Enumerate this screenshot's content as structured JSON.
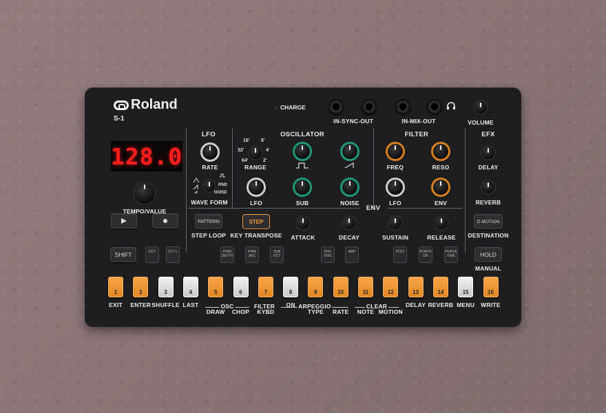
{
  "brand": {
    "logo": "Roland",
    "model": "S-1"
  },
  "top": {
    "charge": "CHARGE",
    "sync": "IN-SYNC-OUT",
    "mix": "IN-MIX-OUT",
    "volume": "VOLUME"
  },
  "display": {
    "value": "128.0"
  },
  "sections": {
    "lfo": "LFO",
    "oscillator": "OSCILLATOR",
    "filter": "FILTER",
    "efx": "EFX",
    "env": "ENV"
  },
  "knobs": {
    "lfo_rate": "RATE",
    "range": "RANGE",
    "wave_form": "WAVE FORM",
    "osc_lfo": "LFO",
    "sub": "SUB",
    "noise": "NOISE",
    "freq": "FREQ",
    "reso": "RESO",
    "filter_lfo": "LFO",
    "filter_env": "ENV",
    "delay": "DELAY",
    "reverb": "REVERB",
    "attack": "ATTACK",
    "decay": "DECAY",
    "sustain": "SUSTAIN",
    "release": "RELEASE",
    "tempo": "TEMPO/VALUE"
  },
  "range_marks": {
    "m16": "16'",
    "m8": "8'",
    "m32": "32'",
    "m4": "4'",
    "m64": "64'",
    "m2": "2'"
  },
  "wave_marks": {
    "rnd": "RND",
    "noise": "NOISE"
  },
  "buttons": {
    "pattern": "PATTERN",
    "step": "STEP",
    "step_loop": "STEP LOOP",
    "key_transpose": "KEY TRANSPOSE",
    "dmotion": "D-MOTION",
    "destination": "DESTINATION",
    "shift": "SHIFT",
    "hold": "HOLD",
    "manual": "MANUAL"
  },
  "tiny_buttons": [
    {
      "t": "OCT-"
    },
    {
      "t": "OCT+"
    },
    {
      "t": "PWM DEPTH"
    },
    {
      "t": "PWM SRC"
    },
    {
      "t": "SUB OCT"
    },
    {
      "t": "ENV TRIG"
    },
    {
      "t": "AMP"
    },
    {
      "t": "POLY"
    },
    {
      "t": "PORTA ON"
    },
    {
      "t": "PORTA TIME"
    }
  ],
  "steps": [
    {
      "n": "1",
      "label": "EXIT",
      "color": "orange"
    },
    {
      "n": "2",
      "label": "ENTER",
      "color": "orange"
    },
    {
      "n": "3",
      "label": "SHUFFLE",
      "color": "white"
    },
    {
      "n": "4",
      "label": "LAST",
      "color": "white"
    },
    {
      "n": "5",
      "label": "DRAW",
      "color": "orange"
    },
    {
      "n": "6",
      "label": "CHOP",
      "color": "white"
    },
    {
      "n": "7",
      "label": "KYBD",
      "color": "orange"
    },
    {
      "n": "8",
      "label": "ON",
      "color": "white"
    },
    {
      "n": "9",
      "label": "TYPE",
      "color": "orange"
    },
    {
      "n": "10",
      "label": "RATE",
      "color": "orange"
    },
    {
      "n": "11",
      "label": "NOTE",
      "color": "orange"
    },
    {
      "n": "12",
      "label": "MOTION",
      "color": "orange"
    },
    {
      "n": "13",
      "label": "DELAY",
      "color": "orange"
    },
    {
      "n": "14",
      "label": "REVERB",
      "color": "orange"
    },
    {
      "n": "15",
      "label": "MENU",
      "color": "white"
    },
    {
      "n": "16",
      "label": "WRITE",
      "color": "orange"
    }
  ],
  "step_groups": {
    "osc": "OSC",
    "filter": "FILTER",
    "arpeggio": "ARPEGGIO",
    "clear": "CLEAR"
  },
  "colors": {
    "body": "#1e1e20",
    "background": "#8b7677",
    "display_red": "#ff1d1d",
    "step_orange": "#e48822",
    "ring_green": "#1e9a7a",
    "ring_orange": "#d8801d"
  }
}
